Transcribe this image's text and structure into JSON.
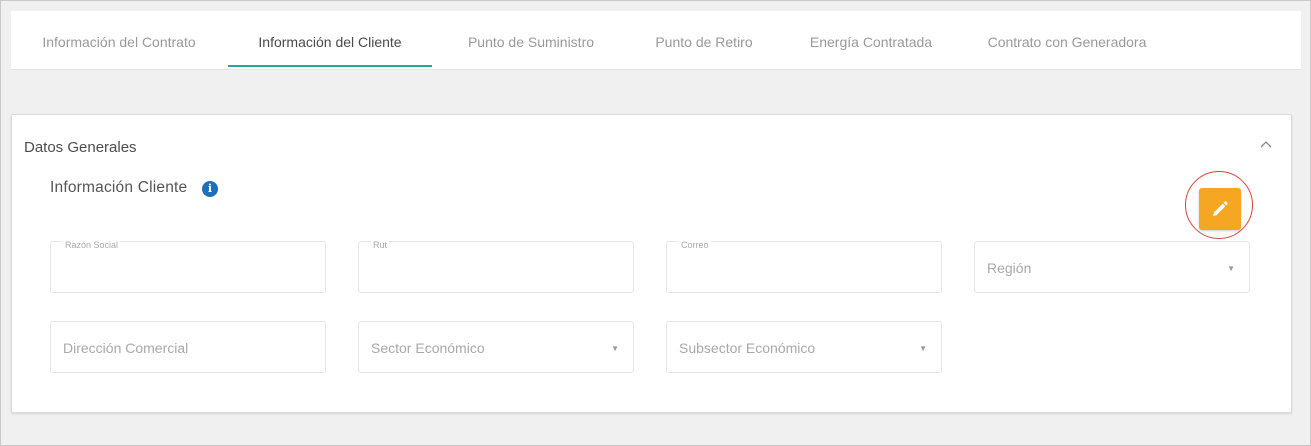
{
  "tabs": [
    {
      "label": "Información del Contrato"
    },
    {
      "label": "Información del Cliente"
    },
    {
      "label": "Punto de Suministro"
    },
    {
      "label": "Punto de Retiro"
    },
    {
      "label": "Energía Contratada"
    },
    {
      "label": "Contrato con Generadora"
    }
  ],
  "active_tab": "Información del Cliente",
  "card": {
    "title": "Datos Generales",
    "section_title": "Información Cliente",
    "collapse_icon": "chevron-up-icon",
    "info_icon": "info-icon",
    "edit_icon": "pencil-icon"
  },
  "fields": {
    "razon_social": {
      "label": "Razón Social",
      "value": ""
    },
    "rut": {
      "label": "Rut",
      "value": ""
    },
    "correo": {
      "label": "Correo",
      "value": ""
    },
    "region": {
      "placeholder": "Región"
    },
    "direccion": {
      "placeholder": "Dirección Comercial"
    },
    "sector": {
      "placeholder": "Sector Económico"
    },
    "subsector": {
      "placeholder": "Subsector Económico"
    }
  },
  "colors": {
    "accent": "#2aa5a0",
    "edit_button": "#f5a623",
    "highlight_ring": "#d9453a",
    "info": "#1f6fb8"
  }
}
